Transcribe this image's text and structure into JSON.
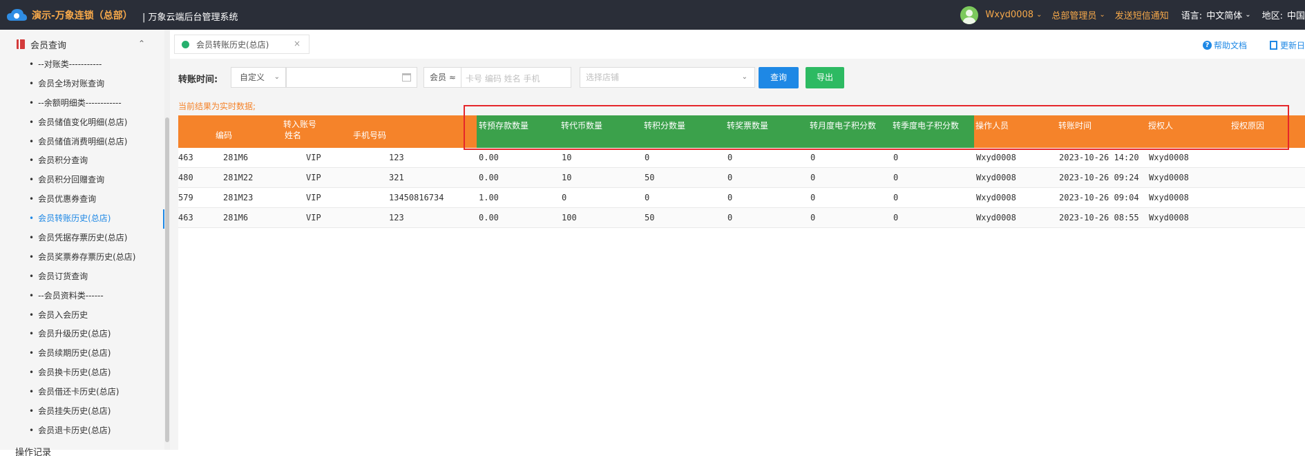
{
  "app": {
    "brand": "演示-万象连锁（总部）",
    "subtitle": "| 万象云端后台管理系统"
  },
  "topbar": {
    "user": "Wxyd0008",
    "role": "总部管理员",
    "sms": "发送短信通知",
    "lang_label": "语言:",
    "lang_value": "中文简体",
    "region_label": "地区:",
    "region_value": "中国"
  },
  "sidebar": {
    "header": "会员查询",
    "items": [
      {
        "label": "--对账类-----------"
      },
      {
        "label": "会员全场对账查询"
      },
      {
        "label": "--余额明细类------------"
      },
      {
        "label": "会员储值变化明细(总店)"
      },
      {
        "label": "会员储值消费明细(总店)"
      },
      {
        "label": "会员积分查询"
      },
      {
        "label": "会员积分回赠查询"
      },
      {
        "label": "会员优惠券查询"
      },
      {
        "label": "会员转账历史(总店)"
      },
      {
        "label": "会员凭据存票历史(总店)"
      },
      {
        "label": "会员奖票券存票历史(总店)"
      },
      {
        "label": "会员订货查询"
      },
      {
        "label": "--会员资料类------"
      },
      {
        "label": "会员入会历史"
      },
      {
        "label": "会员升级历史(总店)"
      },
      {
        "label": "会员续期历史(总店)"
      },
      {
        "label": "会员换卡历史(总店)"
      },
      {
        "label": "会员借还卡历史(总店)"
      },
      {
        "label": "会员挂失历史(总店)"
      },
      {
        "label": "会员退卡历史(总店)"
      }
    ],
    "next_section": "操作记录"
  },
  "tabs": {
    "active": "会员转账历史(总店)",
    "close": "×",
    "help": "帮助文档",
    "update": "更新日"
  },
  "filter": {
    "label": "转账时间:",
    "custom": "自定义",
    "member_prefix": "会员 ≈",
    "member_placeholder": "卡号 编码 姓名 手机",
    "shop_placeholder": "选择店铺",
    "query": "查询",
    "export": "导出"
  },
  "notice": "当前结果为实时数据;",
  "table": {
    "group_header": "转入账号",
    "columns": [
      "编码",
      "姓名",
      "手机号码",
      "转预存款数量",
      "转代币数量",
      "转积分数量",
      "转奖票数量",
      "转月度电子积分数",
      "转季度电子积分数",
      "操作人员",
      "转账时间",
      "授权人",
      "授权原因"
    ],
    "rows": [
      {
        "prefix": "463",
        "code": "281M6",
        "name": "VIP",
        "phone": "123",
        "deposit": "0.00",
        "coin": "10",
        "points": "0",
        "tickets": "0",
        "monthly": "0",
        "quarterly": "0",
        "operator": "Wxyd0008",
        "time": "2023-10-26 14:20",
        "authorizer": "Wxyd0008",
        "reason": ""
      },
      {
        "prefix": "480",
        "code": "281M22",
        "name": "VIP",
        "phone": "321",
        "deposit": "0.00",
        "coin": "10",
        "points": "50",
        "tickets": "0",
        "monthly": "0",
        "quarterly": "0",
        "operator": "Wxyd0008",
        "time": "2023-10-26 09:24",
        "authorizer": "Wxyd0008",
        "reason": ""
      },
      {
        "prefix": "579",
        "code": "281M23",
        "name": "VIP",
        "phone": "13450816734",
        "deposit": "1.00",
        "coin": "0",
        "points": "0",
        "tickets": "0",
        "monthly": "0",
        "quarterly": "0",
        "operator": "Wxyd0008",
        "time": "2023-10-26 09:04",
        "authorizer": "Wxyd0008",
        "reason": ""
      },
      {
        "prefix": "463",
        "code": "281M6",
        "name": "VIP",
        "phone": "123",
        "deposit": "0.00",
        "coin": "100",
        "points": "50",
        "tickets": "0",
        "monthly": "0",
        "quarterly": "0",
        "operator": "Wxyd0008",
        "time": "2023-10-26 08:55",
        "authorizer": "Wxyd0008",
        "reason": ""
      }
    ]
  },
  "colors": {
    "topbar": "#2a2e38",
    "brand": "#f7a94a",
    "header_orange": "#f5832a",
    "header_green": "#3ba14b",
    "accent": "#1e88e5",
    "export": "#2dba62",
    "highlight": "#e5262a"
  }
}
